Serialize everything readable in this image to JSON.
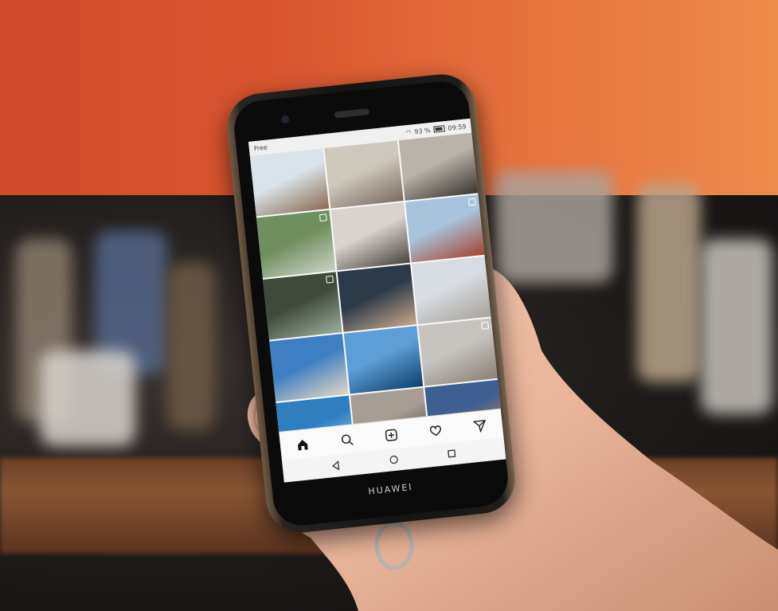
{
  "status_bar": {
    "carrier": "Free",
    "battery": "93 %",
    "time": "09:59"
  },
  "photo_grid": [
    {
      "subject": "wooden-posts-beach",
      "colors": [
        "#d9e3ea",
        "#8b6b52"
      ],
      "multi": false
    },
    {
      "subject": "child-on-sand",
      "colors": [
        "#cfc8bd",
        "#7a6d62"
      ],
      "multi": false
    },
    {
      "subject": "child-with-toy",
      "colors": [
        "#b9b3aa",
        "#3b3530"
      ],
      "multi": false
    },
    {
      "subject": "aerial-green-landscape",
      "colors": [
        "#6f8f5f",
        "#c9d2c5"
      ],
      "multi": true
    },
    {
      "subject": "woman-in-room",
      "colors": [
        "#d8d3cc",
        "#4b4541"
      ],
      "multi": false
    },
    {
      "subject": "red-coast",
      "colors": [
        "#a7c4dc",
        "#a6452f"
      ],
      "multi": true
    },
    {
      "subject": "forest-trees",
      "colors": [
        "#3f4a3b",
        "#9cab9a"
      ],
      "multi": true
    },
    {
      "subject": "woman-at-table",
      "colors": [
        "#2c3a4a",
        "#c8a688"
      ],
      "multi": false
    },
    {
      "subject": "kids-on-beach",
      "colors": [
        "#d7dbe2",
        "#a8a39a"
      ],
      "multi": false
    },
    {
      "subject": "blue-sea-beach",
      "colors": [
        "#3e7fc3",
        "#e2d7c3"
      ],
      "multi": false
    },
    {
      "subject": "underwater-boat",
      "colors": [
        "#5c9ed5",
        "#0f3f6c"
      ],
      "multi": false
    },
    {
      "subject": "child-on-white-sand",
      "colors": [
        "#c7c4c0",
        "#8b7f75"
      ],
      "multi": true
    },
    {
      "subject": "turquoise-sea",
      "colors": [
        "#2f7fc0",
        "#9cd2e6"
      ],
      "multi": false
    },
    {
      "subject": "woman-and-dog",
      "colors": [
        "#a79d92",
        "#3a3430"
      ],
      "multi": false
    },
    {
      "subject": "sunset",
      "colors": [
        "#3d5f91",
        "#e48a45"
      ],
      "multi": false
    }
  ],
  "tab_bar": {
    "icons": [
      "home-icon",
      "search-icon",
      "add-post-icon",
      "heart-icon",
      "send-icon"
    ]
  },
  "system_nav": {
    "icons": [
      "back-icon",
      "home-circle-icon",
      "recents-icon"
    ]
  },
  "brand": "HUAWEI"
}
